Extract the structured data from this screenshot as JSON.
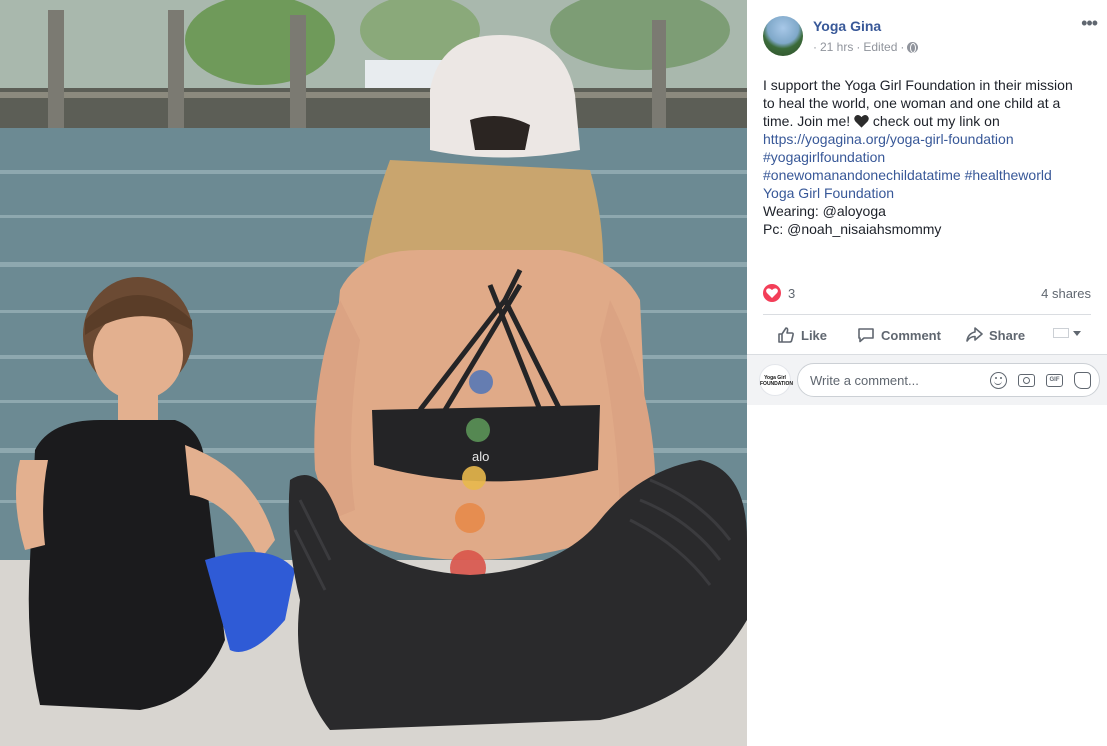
{
  "post": {
    "author": "Yoga Gina",
    "time": "21 hrs",
    "edited": "Edited",
    "separator": "·",
    "more": "•••",
    "text_lines": [
      "I support the Yoga Girl Foundation in their mission",
      "to heal the world, one woman and one child at a",
      "time. Join me!"
    ],
    "text_tail": " check out my link on",
    "link_url": "https://yogagina.org/yoga-girl-foundation",
    "hashtag1": "#yogagirlfoundation",
    "hashtag2": "#onewomanandonechildatatime #healtheworld",
    "page_tag": "Yoga Girl Foundation",
    "wearing": "Wearing: @aloyoga",
    "pc": "Pc: @noah_nisaiahsmommy"
  },
  "reactions": {
    "count": "3",
    "shares": "4 shares"
  },
  "actions": {
    "like": "Like",
    "comment": "Comment",
    "share": "Share"
  },
  "comment_box": {
    "placeholder": "Write a comment...",
    "commenter_logo": "Yoga Girl FOUNDATION",
    "gif_label": "GIF"
  },
  "photo": {
    "top_brand": "alo"
  },
  "colors": {
    "link": "#385898",
    "meta": "#90949c",
    "reaction_heart": "#f33e58",
    "divider": "#dadde1"
  }
}
